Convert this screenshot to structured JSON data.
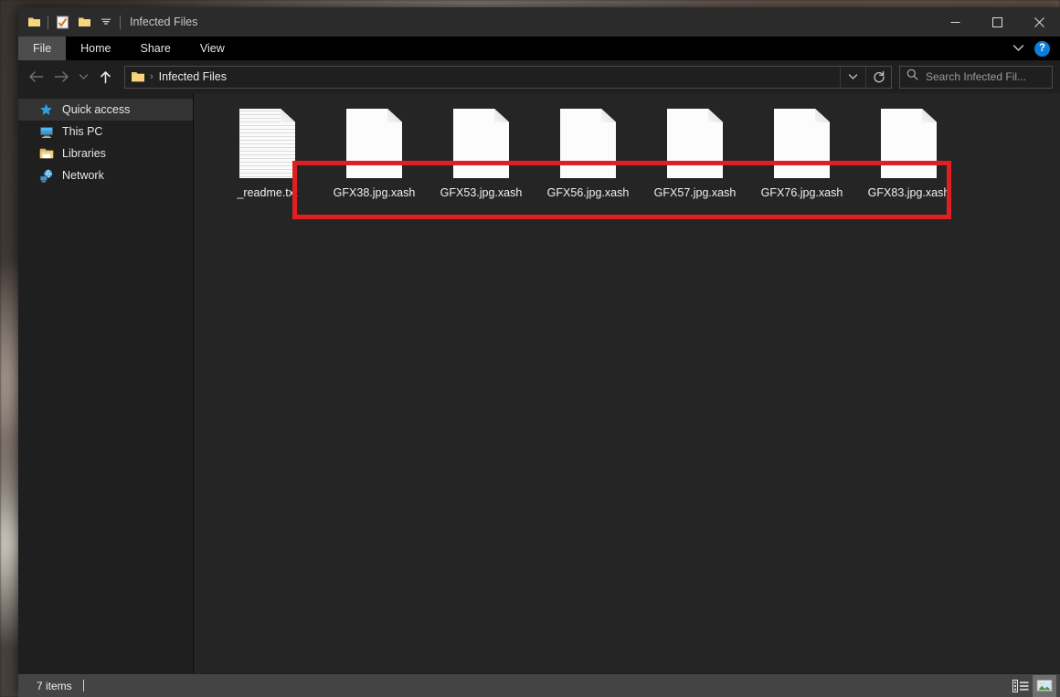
{
  "window": {
    "title": "Infected Files",
    "quick_access_toolbar": [
      {
        "name": "folder-icon",
        "label": "Folder"
      },
      {
        "name": "properties-icon",
        "label": "Properties"
      },
      {
        "name": "new-folder-icon",
        "label": "New folder"
      },
      {
        "name": "chevron-down-icon",
        "label": "Customize Quick Access Toolbar"
      }
    ],
    "controls": {
      "minimize": "–",
      "maximize": "□",
      "close": "✕"
    }
  },
  "ribbon": {
    "tabs": [
      {
        "label": "File",
        "active": true
      },
      {
        "label": "Home",
        "active": false
      },
      {
        "label": "Share",
        "active": false
      },
      {
        "label": "View",
        "active": false
      }
    ],
    "expand_icon": "chevron-down-icon",
    "help_label": "?"
  },
  "navigation": {
    "back": "←",
    "forward": "→",
    "recent": "⌄",
    "up": "↑"
  },
  "address": {
    "folder_icon": "folder-icon",
    "separator": "›",
    "path": "Infected Files",
    "dropdown_icon": "chevron-down-icon",
    "refresh_icon": "refresh-icon"
  },
  "search": {
    "icon": "search-icon",
    "placeholder": "Search Infected Fil..."
  },
  "sidebar": {
    "items": [
      {
        "label": "Quick access",
        "icon": "star-icon",
        "selected": true
      },
      {
        "label": "This PC",
        "icon": "computer-icon",
        "selected": false
      },
      {
        "label": "Libraries",
        "icon": "libraries-folder-icon",
        "selected": false
      },
      {
        "label": "Network",
        "icon": "network-icon",
        "selected": false
      }
    ]
  },
  "files": [
    {
      "name": "_readme.txt",
      "type": "text",
      "encrypted": false
    },
    {
      "name": "GFX38.jpg.xash",
      "type": "blank",
      "encrypted": true
    },
    {
      "name": "GFX53.jpg.xash",
      "type": "blank",
      "encrypted": true
    },
    {
      "name": "GFX56.jpg.xash",
      "type": "blank",
      "encrypted": true
    },
    {
      "name": "GFX57.jpg.xash",
      "type": "blank",
      "encrypted": true
    },
    {
      "name": "GFX76.jpg.xash",
      "type": "blank",
      "encrypted": true
    },
    {
      "name": "GFX83.jpg.xash",
      "type": "blank",
      "encrypted": true
    }
  ],
  "annotation": {
    "color": "#e02020",
    "highlights": "encrypted .xash files"
  },
  "statusbar": {
    "item_count": "7 items",
    "view_buttons": [
      {
        "name": "details-view-button",
        "active": false
      },
      {
        "name": "large-icons-view-button",
        "active": true
      }
    ]
  },
  "colors": {
    "window_bg": "#1f1f1f",
    "content_bg": "#252525",
    "titlebar_bg": "#2b2b2b",
    "ribbon_bg": "#000000",
    "statusbar_bg": "#444444",
    "accent_help": "#0b7ddb",
    "annotation_red": "#e02020"
  }
}
